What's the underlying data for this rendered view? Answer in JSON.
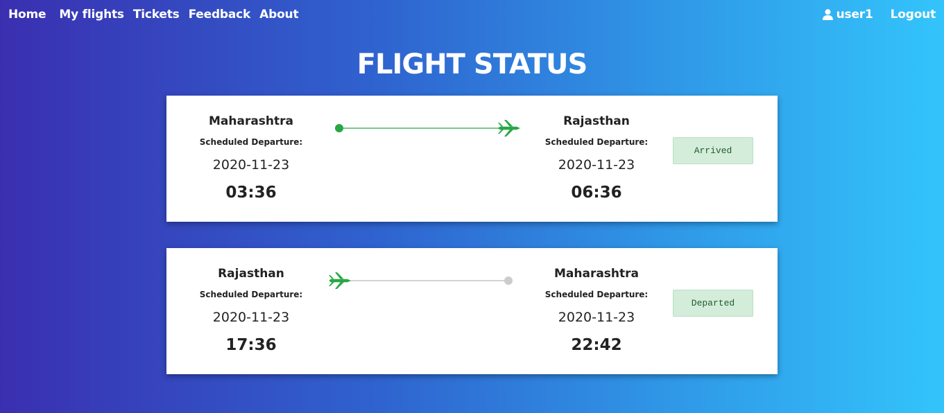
{
  "nav": {
    "links": [
      "Home",
      "My flights",
      "Tickets",
      "Feedback",
      "About"
    ],
    "user": "user1",
    "logout": "Logout"
  },
  "page": {
    "title": "FLIGHT STATUS"
  },
  "flights": [
    {
      "from": {
        "city": "Maharashtra",
        "sched_label": "Scheduled Departure:",
        "date": "2020-11-23",
        "time": "03:36"
      },
      "to": {
        "city": "Rajasthan",
        "sched_label": "Scheduled Departure:",
        "date": "2020-11-23",
        "time": "06:36"
      },
      "status": "Arrived",
      "progress": 1.0
    },
    {
      "from": {
        "city": "Rajasthan",
        "sched_label": "Scheduled Departure:",
        "date": "2020-11-23",
        "time": "17:36"
      },
      "to": {
        "city": "Maharashtra",
        "sched_label": "Scheduled Departure:",
        "date": "2020-11-23",
        "time": "22:42"
      },
      "status": "Departed",
      "progress": 0.0
    }
  ],
  "colors": {
    "plane": "#28a745",
    "route_done": "#28a745",
    "route_pending": "#bbbbbb",
    "dot_pending": "#cccccc"
  },
  "icons": {
    "user": "user-icon",
    "plane": "airplane-icon"
  }
}
